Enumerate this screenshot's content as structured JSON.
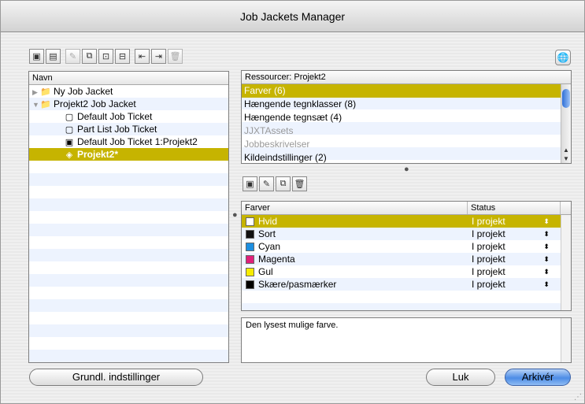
{
  "window": {
    "title": "Job Jackets Manager"
  },
  "toolbar": {
    "buttons": [
      {
        "icon": "new-jacket-icon",
        "glyph": "▣"
      },
      {
        "icon": "new-ticket-icon",
        "glyph": "▤"
      },
      {
        "icon": "edit-icon",
        "glyph": "✎",
        "dim": true
      },
      {
        "icon": "duplicate-icon",
        "glyph": "⧉"
      },
      {
        "icon": "open-icon",
        "glyph": "⊡"
      },
      {
        "icon": "save-icon",
        "glyph": "⊟"
      },
      {
        "icon": "import-icon",
        "glyph": "⇤"
      },
      {
        "icon": "export-icon",
        "glyph": "⇥"
      },
      {
        "icon": "trash-icon",
        "glyph": "🗑",
        "dim": true
      }
    ],
    "globe_icon": "🌐"
  },
  "left": {
    "header": "Navn",
    "items": [
      {
        "label": "Ny Job Jacket",
        "level": 0,
        "triangle": "▶",
        "icon": "📁"
      },
      {
        "label": "Projekt2 Job Jacket",
        "level": 0,
        "triangle": "▼",
        "icon": "📁"
      },
      {
        "label": "Default Job Ticket",
        "level": 1,
        "icon": "▢"
      },
      {
        "label": "Part List Job Ticket",
        "level": 1,
        "icon": "▢"
      },
      {
        "label": "Default Job Ticket 1:Projekt2",
        "level": 1,
        "icon": "▣"
      },
      {
        "label": "Projekt2*",
        "level": 1,
        "icon": "◈",
        "selected": true
      }
    ]
  },
  "resources": {
    "header": "Ressourcer: Projekt2",
    "items": [
      {
        "label": "Farver (6)",
        "selected": true
      },
      {
        "label": "Hængende tegnklasser (8)"
      },
      {
        "label": "Hængende tegnsæt (4)"
      },
      {
        "label": "JJXTAssets",
        "disabled": true
      },
      {
        "label": "Jobbeskrivelser",
        "disabled": true
      },
      {
        "label": "Kildeindstillinger (2)"
      }
    ]
  },
  "color_toolbar": [
    {
      "icon": "new-color-icon",
      "glyph": "▣"
    },
    {
      "icon": "edit-color-icon",
      "glyph": "✎"
    },
    {
      "icon": "duplicate-color-icon",
      "glyph": "⧉"
    },
    {
      "icon": "delete-color-icon",
      "glyph": "🗑"
    }
  ],
  "colors": {
    "col_name": "Farver",
    "col_status": "Status",
    "rows": [
      {
        "name": "Hvid",
        "status": "I projekt",
        "swatch": "#ffffff",
        "selected": true
      },
      {
        "name": "Sort",
        "status": "I projekt",
        "swatch": "#111111"
      },
      {
        "name": "Cyan",
        "status": "I projekt",
        "swatch": "#1e8fe0"
      },
      {
        "name": "Magenta",
        "status": "I projekt",
        "swatch": "#e0207a"
      },
      {
        "name": "Gul",
        "status": "I projekt",
        "swatch": "#f7ec00"
      },
      {
        "name": "Skære/pasmærker",
        "status": "I projekt",
        "swatch": "#000000"
      }
    ],
    "updown_glyph": "⬍"
  },
  "description": "Den lysest mulige farve.",
  "buttons": {
    "settings": "Grundl. indstillinger",
    "close": "Luk",
    "save": "Arkivér"
  }
}
